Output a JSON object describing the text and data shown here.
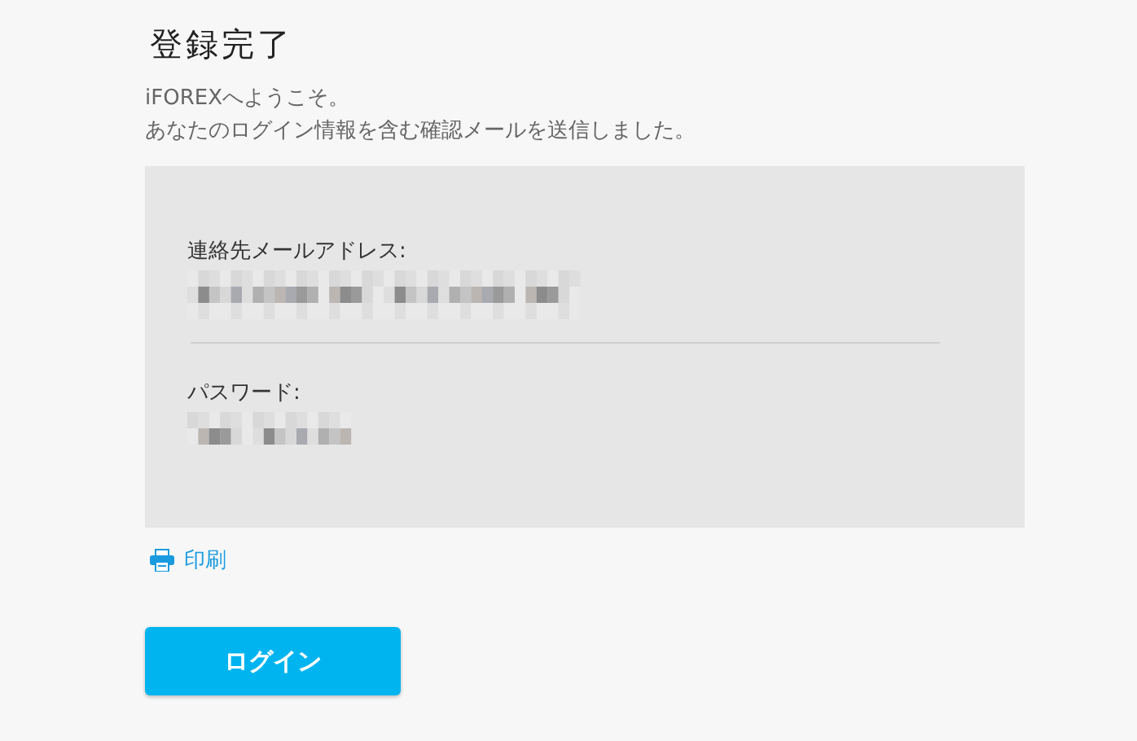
{
  "title": "登録完了",
  "intro_lines": [
    "iFOREXへようこそ。",
    "あなたのログイン情報を含む確認メールを送信しました。"
  ],
  "details": [
    {
      "label": "連絡先メールアドレス:"
    },
    {
      "label": "パスワード:"
    }
  ],
  "print_link": "印刷",
  "login_button": "ログイン"
}
